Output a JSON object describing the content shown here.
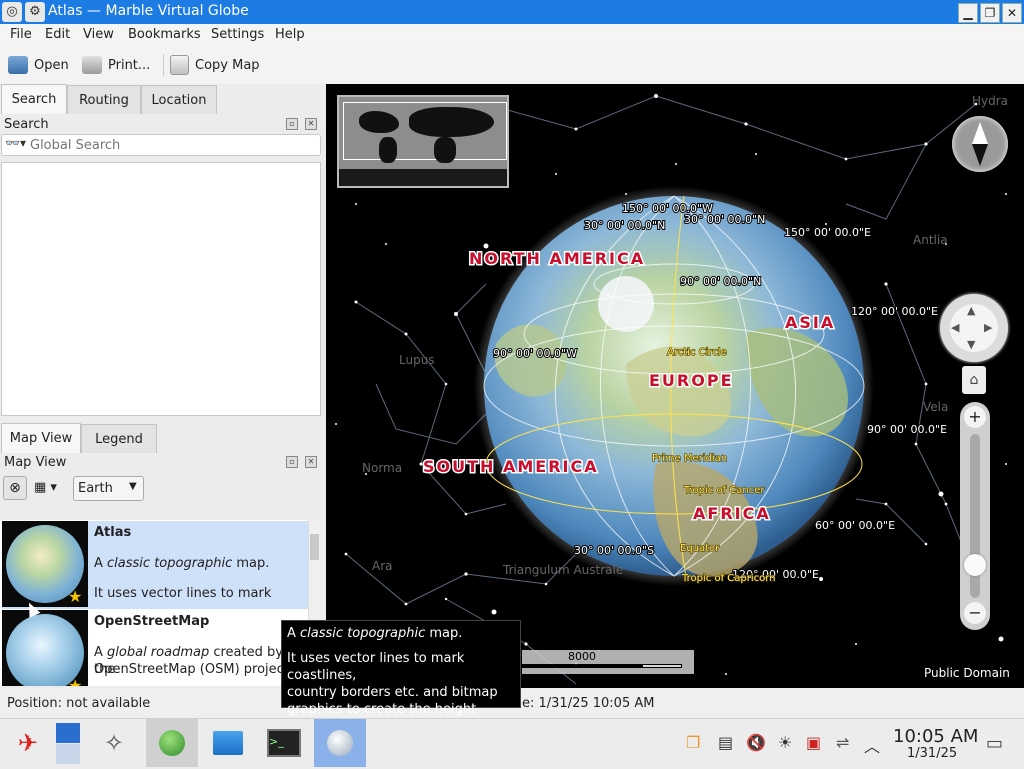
{
  "window": {
    "title": "Atlas — Marble Virtual Globe"
  },
  "menu": {
    "file": "File",
    "edit": "Edit",
    "view": "View",
    "bookmarks": "Bookmarks",
    "settings": "Settings",
    "help": "Help"
  },
  "toolbar": {
    "open": "Open",
    "print": "Print...",
    "copy_map": "Copy Map"
  },
  "tabs": {
    "search": "Search",
    "routing": "Routing",
    "location": "Location"
  },
  "search_panel": {
    "heading": "Search",
    "placeholder": "Global Search"
  },
  "bottom_tabs": {
    "map_view": "Map View",
    "legend": "Legend"
  },
  "map_view_panel": {
    "heading": "Map View",
    "celestial_body": "Earth"
  },
  "maps": [
    {
      "title": "Atlas",
      "desc1_pre": "A ",
      "desc1_em": "classic topographic",
      "desc1_post": " map.",
      "desc2": "It uses vector lines to mark"
    },
    {
      "title": "OpenStreetMap",
      "desc1_pre": "A ",
      "desc1_em": "global roadmap",
      "desc1_post": " created by the",
      "desc2": "OpenStreetMap (OSM) project."
    }
  ],
  "tooltip": {
    "line1_pre": "A ",
    "line1_em": "classic topographic",
    "line1_post": " map.",
    "line2": "It uses vector lines to mark coastlines,",
    "line3": "country borders etc. and bitmap",
    "line4": "graphics to create the height relief."
  },
  "map": {
    "continents": {
      "north_america": "NORTH AMERICA",
      "south_america": "SOUTH AMERICA",
      "europe": "EUROPE",
      "asia": "ASIA",
      "africa": "AFRICA"
    },
    "grid": {
      "lon150w": "150° 00' 00.0\"W",
      "lon30w": "30° 00' 00.0\"N",
      "lat30n": "30° 00' 00.0\"N",
      "lon150e": "150° 00' 00.0\"E",
      "lat90n": "90° 00' 00.0\"N",
      "lon120e": "120° 00' 00.0\"E",
      "lon90w": "90° 00' 00.0\"W",
      "lon90e": "90° 00' 00.0\"E",
      "lon60e": "60° 00' 00.0\"E",
      "lat30s": "30° 00' 00.0\"S",
      "lon120e_b": "120° 00' 00.0\"E"
    },
    "lines": {
      "arctic": "Arctic Circle",
      "prime_meridian": "Prime Meridian",
      "cancer": "Tropic of Cancer",
      "equator": "Equator",
      "capricorn": "Tropic of Capricorn"
    },
    "constellations": {
      "hydra": "Hydra",
      "antlia": "Antlia",
      "lupus": "Lupus",
      "vela": "Vela",
      "norma": "Norma",
      "ara": "Ara",
      "triangulum": "Triangulum Australe"
    },
    "scale": "8000",
    "attribution": "Public Domain"
  },
  "status": {
    "position": "Position: not available",
    "date_suffix": "e: 1/31/25 10:05 AM"
  },
  "clock": {
    "time": "10:05 AM",
    "date": "1/31/25"
  },
  "colors": {
    "titlebar": "#1c7ce4",
    "selection": "#cfe0f9",
    "continent_label": "#c8102e",
    "grid_label_yellow": "#ffe34d"
  }
}
